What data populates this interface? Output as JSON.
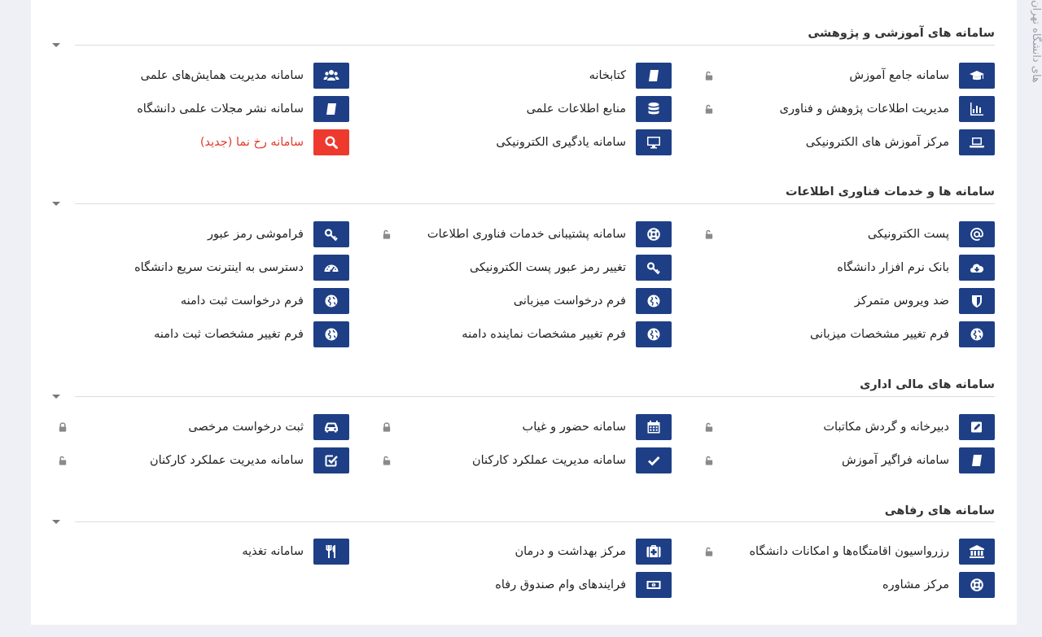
{
  "side_text": "های دانشگاه تهران",
  "sections": [
    {
      "title": "سامانه های آموزشی و پژوهشی",
      "items": [
        {
          "label": "سامانه جامع آموزش",
          "icon": "graduation-cap-icon"
        },
        {
          "label": "کتابخانه",
          "icon": "book-icon"
        },
        {
          "label": "سامانه مدیریت همایش‌های علمی",
          "icon": "users-icon"
        },
        {
          "label": "مدیریت اطلاعات پژوهش و فناوری",
          "icon": "bar-chart-icon"
        },
        {
          "label": "منابع اطلاعات علمی",
          "icon": "database-icon"
        },
        {
          "label": "سامانه نشر مجلات علمی دانشگاه",
          "icon": "book-icon"
        },
        {
          "label": "مرکز آموزش های الکترونیکی",
          "icon": "laptop-icon"
        },
        {
          "label": "سامانه یادگیری الکترونیکی",
          "icon": "monitor-icon"
        },
        {
          "label": "سامانه رخ نما (جدید)",
          "icon": "search-icon",
          "highlight": "#ee3a2e"
        }
      ]
    },
    {
      "title": "سامانه ها و خدمات فناوری اطلاعات",
      "items": [
        {
          "label": "پست الکترونیکی",
          "icon": "at-icon"
        },
        {
          "label": "سامانه پشتیبانی خدمات فناوری اطلاعات",
          "icon": "lifebuoy-icon"
        },
        {
          "label": "فراموشی رمز عبور",
          "icon": "key-icon"
        },
        {
          "label": "بانک نرم افزار دانشگاه",
          "icon": "cloud-download-icon"
        },
        {
          "label": "تغییر رمز عبور پست الکترونیکی",
          "icon": "key-icon"
        },
        {
          "label": "دسترسی به اینترنت سریع دانشگاه",
          "icon": "speedometer-icon"
        },
        {
          "label": "ضد ویروس متمرکز",
          "icon": "shield-icon"
        },
        {
          "label": "فرم درخواست میزبانی",
          "icon": "globe-icon"
        },
        {
          "label": "فرم درخواست ثبت دامنه",
          "icon": "globe-icon"
        },
        {
          "label": "فرم تغییر مشخصات میزبانی",
          "icon": "globe-icon"
        },
        {
          "label": "فرم تغییر مشخصات نماینده دامنه",
          "icon": "globe-icon"
        },
        {
          "label": "فرم تغییر مشخصات ثبت دامنه",
          "icon": "globe-icon"
        }
      ]
    },
    {
      "title": "سامانه های مالی اداری",
      "items": [
        {
          "label": "دبیرخانه و گردش مکاتبات",
          "icon": "edit-icon"
        },
        {
          "label": "سامانه حضور و غیاب",
          "icon": "calendar-icon"
        },
        {
          "label": "ثبت درخواست مرخصی",
          "icon": "car-icon"
        },
        {
          "label": "سامانه فراگیر آموزش",
          "icon": "book-icon"
        },
        {
          "label": "سامانه مدیریت عملکرد کارکنان",
          "icon": "check-icon"
        },
        {
          "label": "سامانه مدیریت عملکرد کارکنان",
          "icon": "check-square-icon"
        }
      ]
    },
    {
      "title": "سامانه های رفاهی",
      "items": [
        {
          "label": "رزرواسیون اقامتگاه‌ها و امکانات دانشگاه",
          "icon": "bank-icon"
        },
        {
          "label": "مرکز بهداشت و درمان",
          "icon": "medkit-icon"
        },
        {
          "label": "سامانه تغذیه",
          "icon": "cutlery-icon"
        },
        {
          "label": "مرکز مشاوره",
          "icon": "lifebuoy-icon"
        },
        {
          "label": "فرایندهای وام صندوق رفاه",
          "icon": "money-icon"
        }
      ]
    }
  ],
  "locks": [
    {
      "section": 0,
      "slot": 0,
      "state": "unlocked"
    },
    {
      "section": 0,
      "slot": 3,
      "state": "unlocked"
    },
    {
      "section": 1,
      "slot": 0,
      "state": "unlocked"
    },
    {
      "section": 1,
      "slot": 1,
      "state": "unlocked"
    },
    {
      "section": 2,
      "slot": 0,
      "state": "unlocked"
    },
    {
      "section": 2,
      "slot": 1,
      "state": "locked"
    },
    {
      "section": 2,
      "slot": 2,
      "state": "locked"
    },
    {
      "section": 2,
      "slot": 3,
      "state": "unlocked"
    },
    {
      "section": 2,
      "slot": 4,
      "state": "unlocked"
    },
    {
      "section": 2,
      "slot": 5,
      "state": "unlocked"
    },
    {
      "section": 3,
      "slot": 0,
      "state": "unlocked"
    }
  ],
  "colors": {
    "accent": "#1e3f86",
    "highlight": "#ee3a2e",
    "lock": "#8a8a8a"
  }
}
